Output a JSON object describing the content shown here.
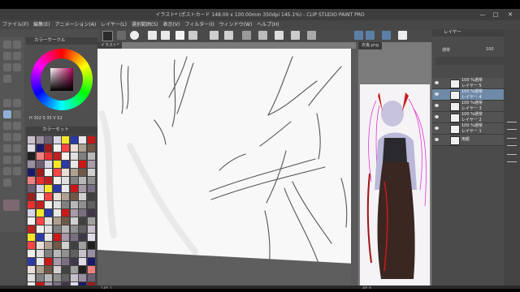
{
  "window": {
    "title": "イラスト* (ポストカード 148.00 x 100.00mm 350dpi 145.1%) - CLIP STUDIO PAINT PRO",
    "minimize": "—",
    "maximize": "□",
    "close": "✕"
  },
  "menu": {
    "items": [
      "ファイル(F)",
      "編集(E)",
      "アニメーション(A)",
      "レイヤー(L)",
      "選択範囲(S)",
      "表示(V)",
      "フィルター(I)",
      "ウィンドウ(W)",
      "ヘルプ(H)"
    ]
  },
  "color_panel": {
    "title": "カラーサークル",
    "hsv": [
      "H",
      "302",
      "S",
      "35",
      "V",
      "52"
    ]
  },
  "swatch_panel": {
    "title": "カラーセット"
  },
  "canvas": {
    "tab_label": "イラスト*"
  },
  "reference": {
    "tab_label": "赤鬼.png"
  },
  "layers": {
    "title": "レイヤー",
    "blend_mode": "通常",
    "opacity": "100",
    "items": [
      {
        "name_line1": "100 %通常",
        "name_line2": "レイヤー 5"
      },
      {
        "name_line1": "100 %通常",
        "name_line2": "レイヤー 4"
      },
      {
        "name_line1": "100 %通常",
        "name_line2": "レイヤー 3"
      },
      {
        "name_line1": "100 %通常",
        "name_line2": "レイヤー 2"
      },
      {
        "name_line1": "100 %通常",
        "name_line2": "レイヤー 1"
      },
      {
        "name_line1": "",
        "name_line2": "用紙"
      }
    ]
  },
  "status": {
    "left": "145.1",
    "ref": "48.6"
  },
  "colors": {
    "accent": "#6f8aa8",
    "hair": "#ff00ff"
  }
}
